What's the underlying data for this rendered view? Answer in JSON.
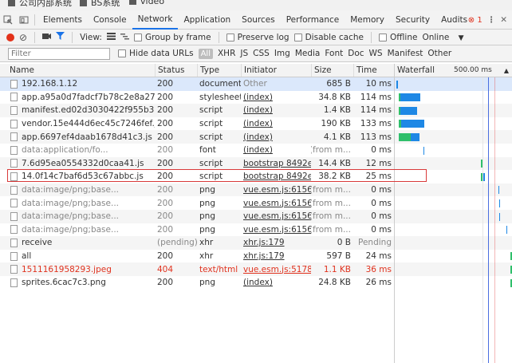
{
  "bookmarks": [
    {
      "label": "公司内部系统"
    },
    {
      "label": "BS系统"
    },
    {
      "label": "video"
    }
  ],
  "tabs": [
    "Elements",
    "Console",
    "Network",
    "Application",
    "Sources",
    "Performance",
    "Memory",
    "Security",
    "Audits"
  ],
  "active_tab": "Network",
  "error_count": "1",
  "toolbar": {
    "view_label": "View:",
    "group_by_frame": "Group by frame",
    "preserve_log": "Preserve log",
    "disable_cache": "Disable cache",
    "offline": "Offline",
    "throttle": "Online"
  },
  "filter": {
    "placeholder": "Filter",
    "hide_data_urls": "Hide data URLs",
    "types": [
      "All",
      "XHR",
      "JS",
      "CSS",
      "Img",
      "Media",
      "Font",
      "Doc",
      "WS",
      "Manifest",
      "Other"
    ]
  },
  "columns": {
    "name": "Name",
    "status": "Status",
    "type": "Type",
    "initiator": "Initiator",
    "size": "Size",
    "time": "Time",
    "waterfall": "Waterfall",
    "waterfall_scale": "500.00 ms"
  },
  "rows": [
    {
      "name": "192.168.1.12",
      "status": "200",
      "type": "document",
      "initiator": "Other",
      "size": "685 B",
      "time": "10 ms"
    },
    {
      "name": "app.a95a0d7fadcf7b78c2e8a27774...",
      "status": "200",
      "type": "stylesheet",
      "initiator": "(index)",
      "size": "34.8 KB",
      "time": "114 ms"
    },
    {
      "name": "manifest.ed02d3030422f955b337.js",
      "status": "200",
      "type": "script",
      "initiator": "(index)",
      "size": "1.4 KB",
      "time": "114 ms"
    },
    {
      "name": "vendor.15e444d6ec45c7246fef.js",
      "status": "200",
      "type": "script",
      "initiator": "(index)",
      "size": "190 KB",
      "time": "133 ms"
    },
    {
      "name": "app.6697ef4daab1678d41c3.js",
      "status": "200",
      "type": "script",
      "initiator": "(index)",
      "size": "4.1 KB",
      "time": "113 ms"
    },
    {
      "name": "data:application/fo...",
      "status": "200",
      "type": "font",
      "initiator": "(index)",
      "size": "(from m...",
      "time": "0 ms"
    },
    {
      "name": "7.6d95ea0554332d0caa41.js",
      "status": "200",
      "type": "script",
      "initiator": "bootstrap 8492e...",
      "size": "14.4 KB",
      "time": "12 ms"
    },
    {
      "name": "14.0f14c7baf6d53c67abbc.js",
      "status": "200",
      "type": "script",
      "initiator": "bootstrap 8492e...",
      "size": "38.2 KB",
      "time": "25 ms"
    },
    {
      "name": "data:image/png;base...",
      "status": "200",
      "type": "png",
      "initiator": "vue.esm.js:6156",
      "size": "(from m...",
      "time": "0 ms"
    },
    {
      "name": "data:image/png;base...",
      "status": "200",
      "type": "png",
      "initiator": "vue.esm.js:6156",
      "size": "(from m...",
      "time": "0 ms"
    },
    {
      "name": "data:image/png;base...",
      "status": "200",
      "type": "png",
      "initiator": "vue.esm.js:6156",
      "size": "(from m...",
      "time": "0 ms"
    },
    {
      "name": "data:image/png;base...",
      "status": "200",
      "type": "png",
      "initiator": "vue.esm.js:6156",
      "size": "(from m...",
      "time": "0 ms"
    },
    {
      "name": "receive",
      "status": "(pending)",
      "type": "xhr",
      "initiator": "xhr.js:179",
      "size": "0 B",
      "time": "Pending"
    },
    {
      "name": "all",
      "status": "200",
      "type": "xhr",
      "initiator": "xhr.js:179",
      "size": "597 B",
      "time": "24 ms"
    },
    {
      "name": "1511161958293.jpeg",
      "status": "404",
      "type": "text/html",
      "initiator": "vue.esm.js:5178",
      "size": "1.1 KB",
      "time": "36 ms"
    },
    {
      "name": "sprites.6cac7c3.png",
      "status": "200",
      "type": "png",
      "initiator": "(index)",
      "size": "24.8 KB",
      "time": "26 ms"
    }
  ],
  "colors": {
    "accent": "#1a73e8",
    "error": "#e0321e",
    "waiting": "#2fbf6b",
    "download": "#1e88e5"
  },
  "icons": {
    "inspect": "inspect-icon",
    "device": "device-toolbar-icon",
    "record": "record-icon",
    "clear": "clear-icon",
    "camera": "capture-screenshots-icon",
    "filter": "filter-icon",
    "large_rows": "large-rows-icon",
    "overview": "overview-icon",
    "more": "more-vert-icon",
    "close": "close-icon",
    "dropdown": "chevron-down-icon",
    "sort": "sort-up-icon"
  }
}
